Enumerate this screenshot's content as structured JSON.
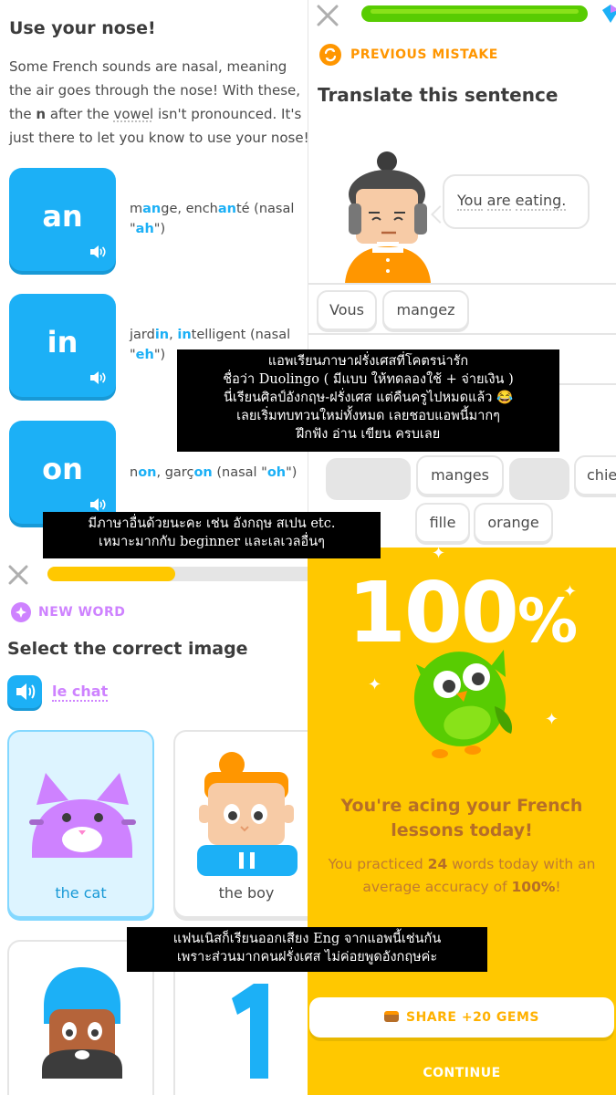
{
  "nose_panel": {
    "title": "Use your nose!",
    "desc_1": "Some French sounds are nasal, meaning the air goes through the nose! With these, the ",
    "desc_n": "n",
    "desc_2": " after the ",
    "desc_vowel": "vowel",
    "desc_3": " isn't pronounced. It's just there to let you know to use your nose!",
    "sounds": [
      {
        "letters": "an",
        "w1a": "m",
        "w1b": "an",
        "w1c": "ge, ench",
        "w1d": "an",
        "w1e": "té (nasal \"",
        "w1f": "ah",
        "w1g": "\")"
      },
      {
        "letters": "in",
        "w1a": "jard",
        "w1b": "in",
        "w1c": ", ",
        "w1d": "in",
        "w1e": "telligent (nasal \"",
        "w1f": "eh",
        "w1g": "\")"
      },
      {
        "letters": "on",
        "w1a": "",
        "w1b": "on",
        "w1c": ", garç",
        "w1d": "on",
        "w1e": " (nasal \"",
        "w1f": "oh",
        "w1g": "\")"
      }
    ],
    "n_label": "n",
    "prefix_non": "n"
  },
  "translate_panel": {
    "label": "PREVIOUS MISTAKE",
    "heading": "Translate this sentence",
    "bubble_w1": "You",
    "bubble_w2": "are",
    "bubble_w3": "eating.",
    "answer_words": [
      "Vous",
      "mangez"
    ],
    "bank_words": [
      "manges",
      "chie",
      "fille",
      "orange"
    ]
  },
  "image_panel": {
    "label": "NEW WORD",
    "heading": "Select the correct image",
    "word": "le chat",
    "options": [
      "the cat",
      "the boy"
    ]
  },
  "complete_panel": {
    "big_num": "100",
    "big_pct": "%",
    "heading": "You're acing your French lessons today!",
    "body_1": "You practiced ",
    "body_count": "24",
    "body_2": " words today with an average accuracy of ",
    "body_acc": "100%",
    "body_3": "!",
    "share": "SHARE +20 GEMS",
    "continue": "CONTINUE"
  },
  "captions": {
    "c1_l1": "แอพเรียนภาษาฝรั่งเศสที่โคตรน่ารัก",
    "c1_l2": "ชื่อว่า Duolingo ( มีแบบ ให้ทดลองใช้ + จ่ายเงิน )",
    "c1_l3": "นี่เรียนศิลป์อังกฤษ-ฝรั่งเศส แต่คืนครูไปหมดแล้ว 😂",
    "c1_l4": "เลยเริ่มทบทวนใหม่ทั้งหมด เลยชอบแอพนี้มากๆ",
    "c1_l5": "ฝึกฟัง อ่าน เขียน ครบเลย",
    "c2_l1": "มีภาษาอื่นด้วยนะคะ เช่น อังกฤษ สเปน etc.",
    "c2_l2": "เหมาะมากกับ beginner และเลเวลอื่นๆ",
    "c3_l1": "แฟนเนิสก็เรียนออกเสียง Eng จากแอพนี้เช่นกัน",
    "c3_l2": "เพราะส่วนมากคนฝรั่งเศส ไม่ค่อยพูดอังกฤษค่ะ"
  },
  "colors": {
    "blue": "#1cb0f6",
    "green": "#58cc02",
    "orange": "#ff9600",
    "purple": "#ce82ff",
    "yellow": "#ffc800"
  }
}
